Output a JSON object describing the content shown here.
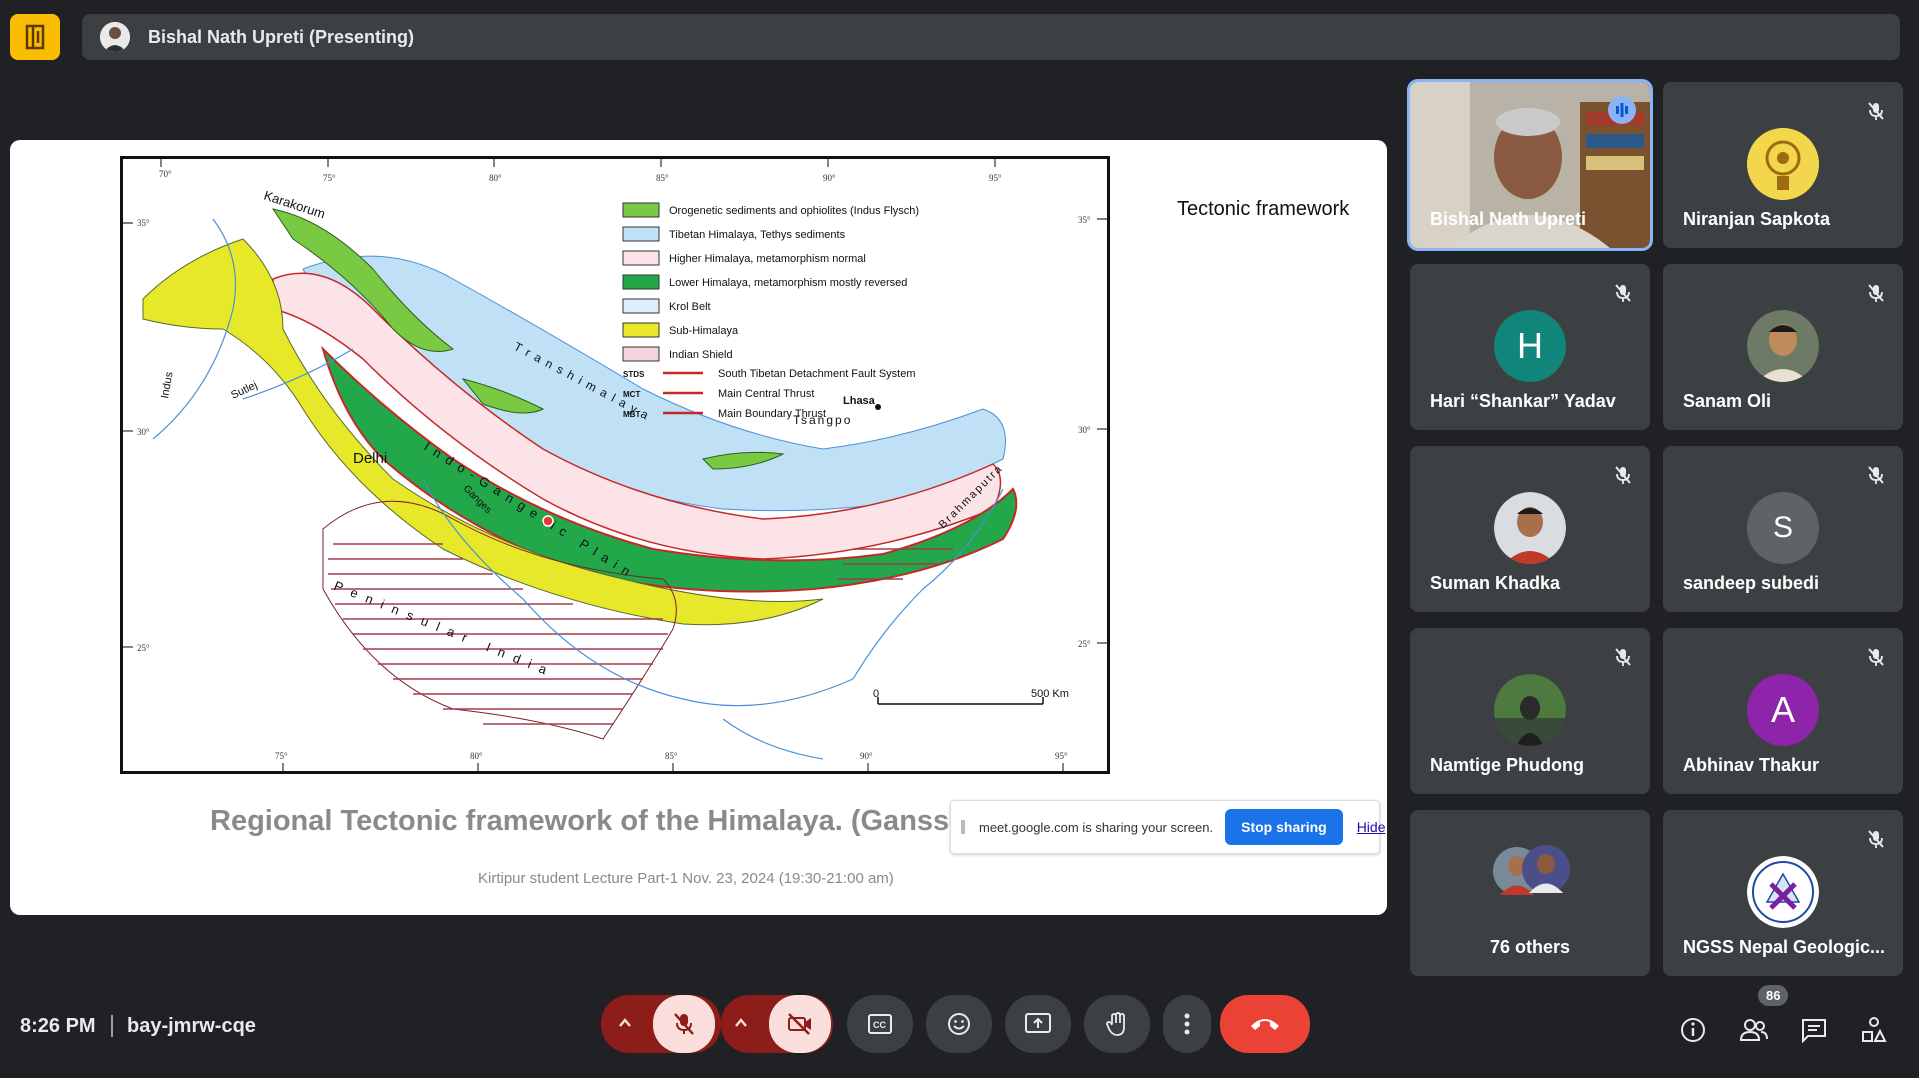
{
  "topbar": {
    "presenter_label": "Bishal Nath Upreti (Presenting)"
  },
  "slide": {
    "heading": "Tectonic framework",
    "title": "Regional Tectonic framework of the Himalaya. (Gansse",
    "subtitle": "Kirtipur student Lecture  Part-1 Nov. 23, 2024 (19:30-21:00 am)",
    "map": {
      "legend": [
        {
          "label": "Orogenetic sediments and ophiolites (Indus Flysch)",
          "color": "#7ac943"
        },
        {
          "label": "Tibetan Himalaya, Tethys sediments",
          "color": "#bfe0f5"
        },
        {
          "label": "Higher Himalaya, metamorphism normal",
          "color": "#fbe3e8"
        },
        {
          "label": "Lower Himalaya, metamorphism mostly reversed",
          "color": "#22a84a"
        },
        {
          "label": "Krol Belt",
          "color": "#dfeefb"
        },
        {
          "label": "Sub-Himalaya",
          "color": "#e8e82a"
        },
        {
          "label": "Indian Shield",
          "color": "#f4d4dc"
        }
      ],
      "faults": [
        {
          "code": "STDS",
          "label": "South Tibetan Detachment Fault System"
        },
        {
          "code": "MCT",
          "label": "Main Central Thrust"
        },
        {
          "code": "MBT",
          "label": "Main Boundary Thrust"
        }
      ],
      "place_labels": [
        "Karakorum",
        "Indus",
        "Sutlej",
        "Delhi",
        "Lhasa",
        "Tsangpo",
        "Transhimalaya",
        "Indo-Gangetic Plain",
        "Ganges",
        "Brahmaputra",
        "Peninsular India"
      ],
      "scale_label": "500 Km",
      "scale_zero": "0",
      "lon_ticks": [
        "70°",
        "75°",
        "80°",
        "85°",
        "90°",
        "95°"
      ],
      "lat_ticks": [
        "35°",
        "30°",
        "25°"
      ]
    },
    "share_banner": {
      "text": "meet.google.com is sharing your screen.",
      "stop": "Stop sharing",
      "hide": "Hide"
    }
  },
  "participants": [
    {
      "name": "Bishal Nath Upreti",
      "type": "video",
      "speaking": true
    },
    {
      "name": "Niranjan Sapkota",
      "type": "logo",
      "muted": true
    },
    {
      "name": "Hari “Shankar” Yadav",
      "type": "letter",
      "letter": "H",
      "color": "#12857a",
      "muted": true
    },
    {
      "name": "Sanam Oli",
      "type": "photo",
      "muted": true
    },
    {
      "name": "Suman Khadka",
      "type": "photo",
      "muted": true
    },
    {
      "name": "sandeep subedi",
      "type": "letter",
      "letter": "S",
      "color": "#5f6368",
      "muted": true
    },
    {
      "name": "Namtige Phudong",
      "type": "photo",
      "muted": true
    },
    {
      "name": "Abhinav Thakur",
      "type": "letter",
      "letter": "A",
      "color": "#8e24aa",
      "muted": true
    },
    {
      "name": "76 others",
      "type": "group"
    },
    {
      "name": "NGSS Nepal Geologic...",
      "type": "logo",
      "muted": true
    }
  ],
  "bottombar": {
    "time": "8:26 PM",
    "meeting_code": "bay-jmrw-cqe",
    "people_count": "86"
  },
  "colors": {
    "accent": "#1a73e8",
    "end_call": "#ea4335",
    "mute_bg": "#8c1d18"
  }
}
